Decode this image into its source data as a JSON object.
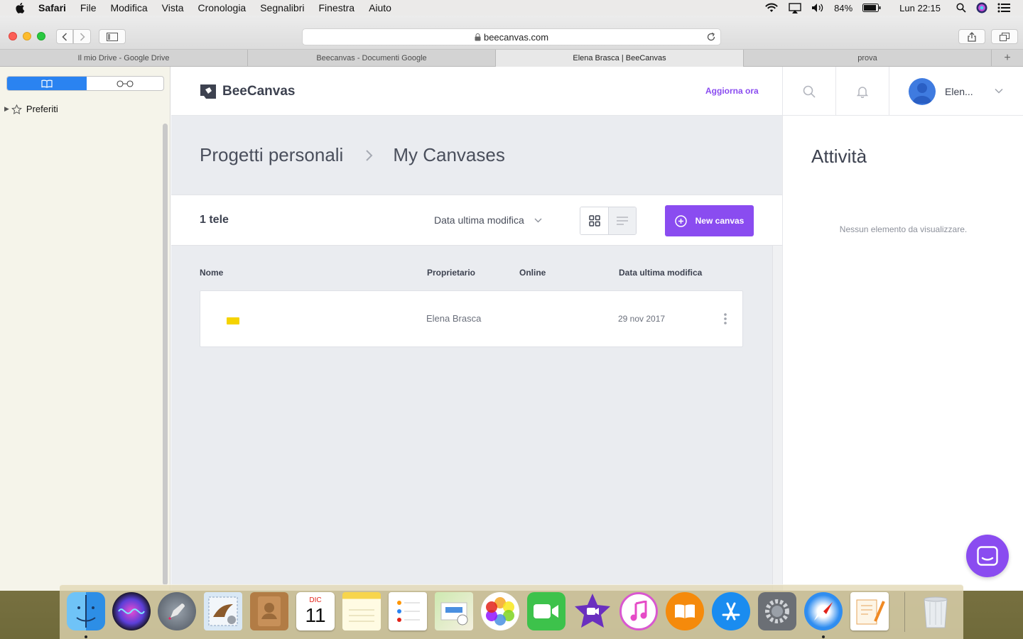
{
  "menubar": {
    "app_name": "Safari",
    "menus": [
      "File",
      "Modifica",
      "Vista",
      "Cronologia",
      "Segnalibri",
      "Finestra",
      "Aiuto"
    ],
    "battery": "84%",
    "clock": "Lun 22:15"
  },
  "browser": {
    "url": "beecanvas.com",
    "tabs": [
      {
        "label": "Il mio Drive - Google Drive",
        "active": false
      },
      {
        "label": "Beecanvas - Documenti Google",
        "active": false
      },
      {
        "label": "Elena Brasca | BeeCanvas",
        "active": true
      },
      {
        "label": "prova",
        "active": false
      }
    ],
    "new_tab_label": "+"
  },
  "sidebar": {
    "favorites_label": "Preferiti"
  },
  "app": {
    "logo_text": "BeeCanvas",
    "upgrade_label": "Aggiorna ora",
    "user_name": "Elen...",
    "breadcrumb": [
      "Progetti personali",
      "My Canvases"
    ],
    "breadcrumb_separator": "›",
    "count_label": "1 tele",
    "sort_label": "Data ultima modifica",
    "new_canvas_label": "New canvas",
    "columns": [
      "Nome",
      "Proprietario",
      "Online",
      "Data ultima modifica"
    ],
    "rows": [
      {
        "name": "",
        "owner": "Elena Brasca",
        "online": "",
        "modified": "29 nov 2017"
      }
    ],
    "activity_title": "Attività",
    "activity_empty": "Nessun elemento da visualizzare.",
    "brand_color": "#8a4cf0"
  },
  "dock": {
    "apps": [
      "Finder",
      "Siri",
      "Launchpad",
      "Mail",
      "Contatti",
      "Calendario",
      "Note",
      "Promemoria",
      "Mappe",
      "Foto",
      "FaceTime",
      "iMovie",
      "iTunes",
      "iBooks",
      "App Store",
      "Preferenze di Sistema",
      "Safari",
      "Pages",
      "Cestino"
    ],
    "calendar_month": "DIC",
    "calendar_day": "11"
  }
}
